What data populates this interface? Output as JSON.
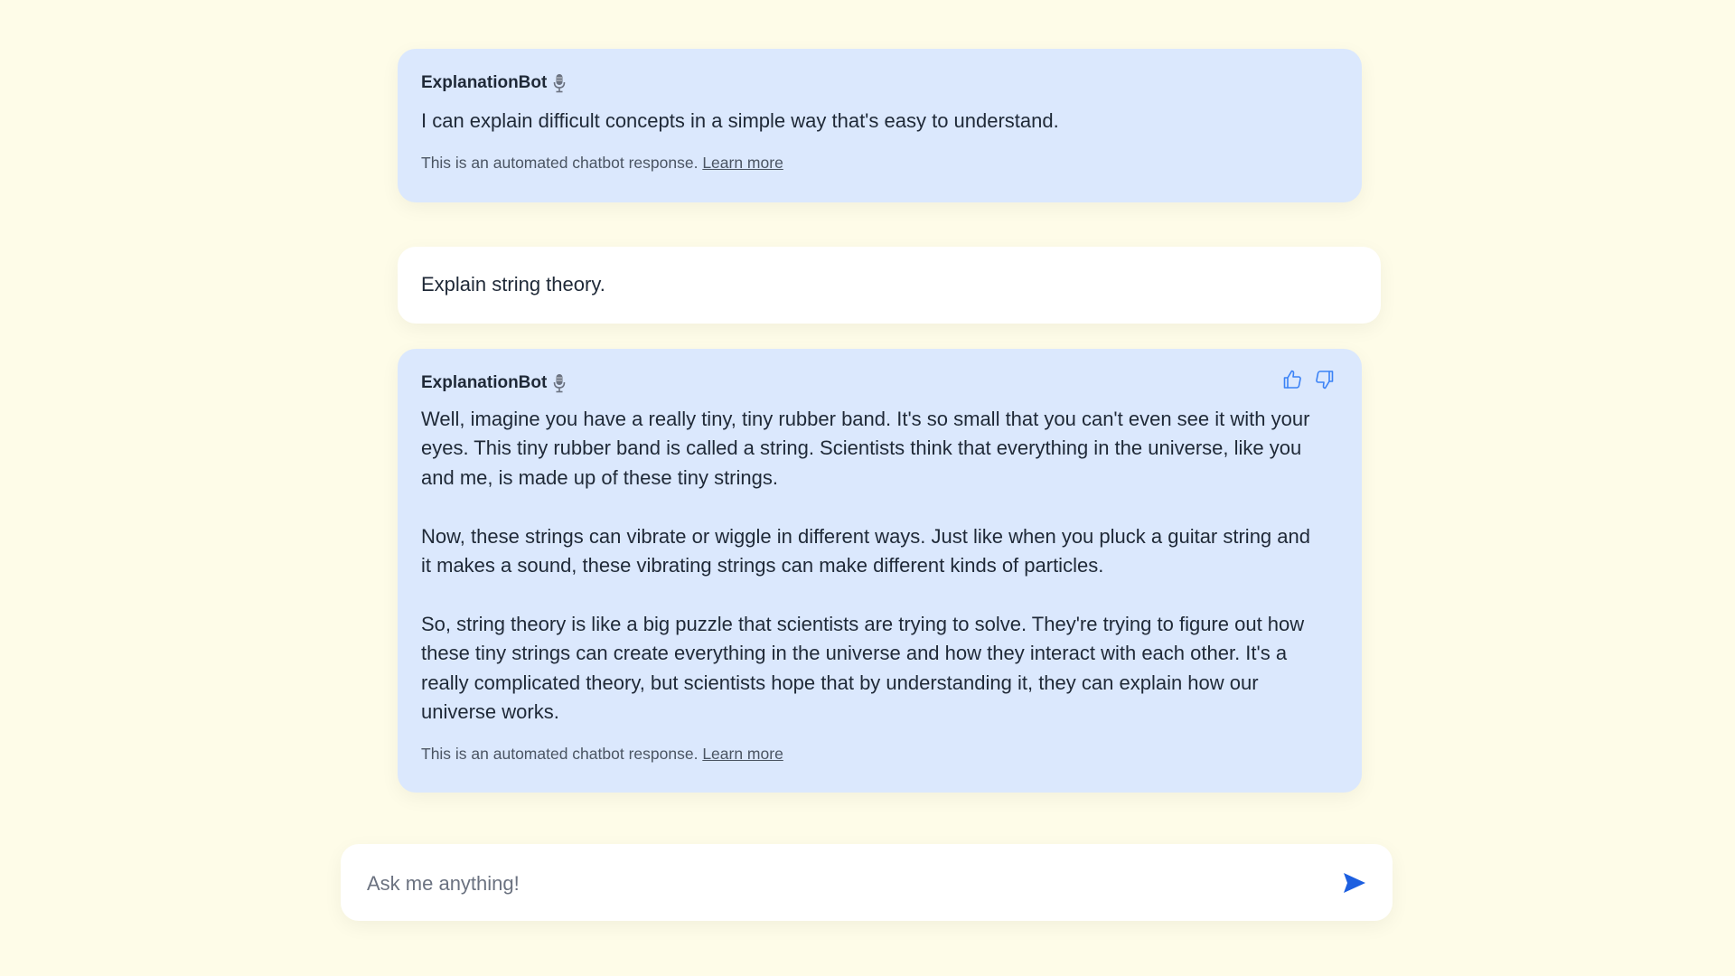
{
  "colors": {
    "page_background": "#fefce8",
    "bot_bubble": "#dbe8fd",
    "user_bubble": "#ffffff",
    "accent": "#1d5fe0",
    "text": "#1f2937",
    "muted": "#4b5563"
  },
  "messages": [
    {
      "role": "bot",
      "sender": "ExplanationBot",
      "sender_icon": "microphone-icon",
      "text": "I can explain difficult concepts in a simple way that's easy to understand.",
      "disclaimer": "This is an automated chatbot response.",
      "learn_more": "Learn more"
    },
    {
      "role": "user",
      "text": "Explain string theory."
    },
    {
      "role": "bot",
      "sender": "ExplanationBot",
      "sender_icon": "microphone-icon",
      "feedback_icons": [
        "thumbs-up-icon",
        "thumbs-down-icon"
      ],
      "paragraphs": [
        "Well, imagine you have a really tiny, tiny rubber band. It's so small that you can't even see it with your eyes. This tiny rubber band is called a string. Scientists think that everything in the universe, like you and me, is made up of these tiny strings.",
        "Now, these strings can vibrate or wiggle in different ways. Just like when you pluck a guitar string and it makes a sound, these vibrating strings can make different kinds of particles.",
        "So, string theory is like a big puzzle that scientists are trying to solve. They're trying to figure out how these tiny strings can create everything in the universe and how they interact with each other. It's a really complicated theory, but scientists hope that by understanding it, they can explain how our universe works."
      ],
      "disclaimer": "This is an automated chatbot response.",
      "learn_more": "Learn more"
    }
  ],
  "composer": {
    "placeholder": "Ask me anything!",
    "send_icon": "send-icon"
  }
}
